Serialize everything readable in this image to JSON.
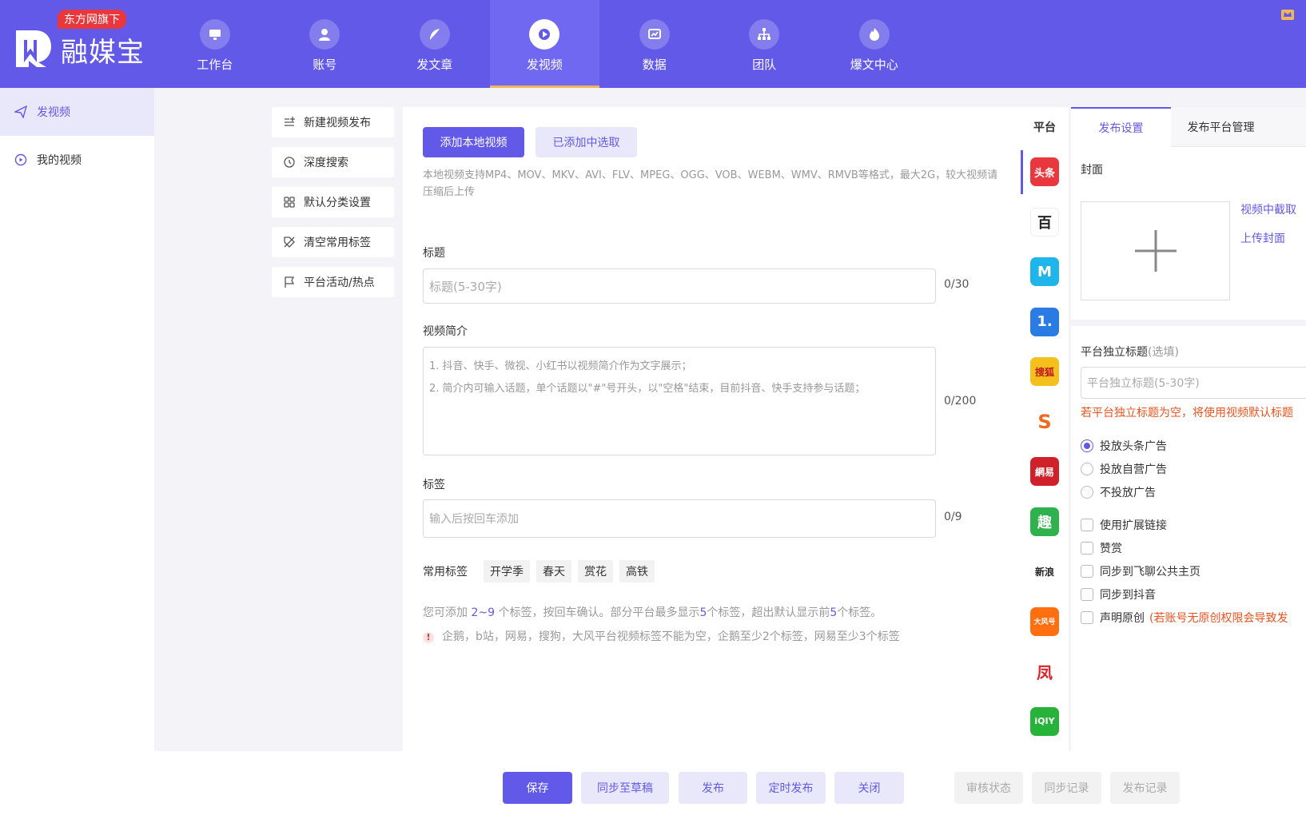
{
  "brand": {
    "name": "融媒宝",
    "badge": "东方网旗下"
  },
  "nav": [
    {
      "label": "工作台",
      "icon": "monitor-icon"
    },
    {
      "label": "账号",
      "icon": "user-icon"
    },
    {
      "label": "发文章",
      "icon": "feather-icon"
    },
    {
      "label": "发视频",
      "icon": "video-play-icon",
      "active": true
    },
    {
      "label": "数据",
      "icon": "chart-icon"
    },
    {
      "label": "团队",
      "icon": "team-icon"
    },
    {
      "label": "爆文中心",
      "icon": "fire-icon"
    }
  ],
  "sidebar": [
    {
      "label": "发视频",
      "active": true
    },
    {
      "label": "我的视频"
    }
  ],
  "tools": [
    "新建视频发布",
    "深度搜索",
    "默认分类设置",
    "清空常用标签",
    "平台活动/热点"
  ],
  "form": {
    "add_local_btn": "添加本地视频",
    "select_added_btn": "已添加中选取",
    "format_hint": "本地视频支持MP4、MOV、MKV、AVI、FLV、MPEG、OGG、VOB、WEBM、WMV、RMVB等格式，最大2G，较大视频请压缩后上传",
    "title_label": "标题",
    "title_placeholder": "标题(5-30字)",
    "title_counter": "0/30",
    "intro_label": "视频简介",
    "intro_placeholder_1": "1. 抖音、快手、微视、小红书以视频简介作为文字展示；",
    "intro_placeholder_2": "2. 简介内可输入话题，单个话题以\"#\"号开头，以\"空格\"结束，目前抖音、快手支持参与话题；",
    "intro_counter": "0/200",
    "tags_label": "标签",
    "tags_placeholder": "输入后按回车添加",
    "tags_counter": "0/9",
    "common_tags_label": "常用标签",
    "common_tags": [
      "开学季",
      "春天",
      "赏花",
      "高铁"
    ],
    "tag_hint_a": "您可添加 ",
    "tag_hint_b": "2~9",
    "tag_hint_c": " 个标签，按回车确认。部分平台最多显示",
    "tag_hint_d": "5",
    "tag_hint_e": "个标签，超出默认显示前",
    "tag_hint_f": "5",
    "tag_hint_g": "个标签。",
    "warning": "企鹅，b站，网易，搜狗，大风平台视频标签不能为空，企鹅至少2个标签，网易至少3个标签"
  },
  "platforms": {
    "header": "平台",
    "items": [
      {
        "name": "toutiao",
        "text": "头条",
        "color": "#e8383d"
      },
      {
        "name": "baijiahao",
        "text": "百",
        "color": "#ffffff"
      },
      {
        "name": "dayu",
        "text": "M",
        "color": "#1fb5ea"
      },
      {
        "name": "yidian",
        "text": "1.",
        "color": "#2a7be4"
      },
      {
        "name": "sohu",
        "text": "搜狐",
        "color": "#f3c01c"
      },
      {
        "name": "qiehao",
        "text": "S",
        "color": "#ffffff"
      },
      {
        "name": "wangyi",
        "text": "網易",
        "color": "#d0202a"
      },
      {
        "name": "qutoutiao",
        "text": "趣",
        "color": "#2fb24d"
      },
      {
        "name": "sina",
        "text": "新浪",
        "color": "#ffffff"
      },
      {
        "name": "dafeng",
        "text": "大风号",
        "color": "#ff6f0f"
      },
      {
        "name": "fenghuang",
        "text": "凤",
        "color": "#ffffff"
      },
      {
        "name": "iqiyi",
        "text": "iQIY",
        "color": "#27b339"
      }
    ]
  },
  "settings": {
    "tab_publish": "发布设置",
    "tab_manage": "发布平台管理",
    "cover_label": "封面",
    "capture_link": "视频中截取",
    "upload_link": "上传封面",
    "indep_title_label": "平台独立标题",
    "indep_title_optional": "(选填)",
    "indep_title_placeholder": "平台独立标题(5-30字)",
    "indep_title_warning": "若平台独立标题为空，将使用视频默认标题",
    "ad_options": [
      "投放头条广告",
      "投放自营广告",
      "不投放广告"
    ],
    "checks": [
      "使用扩展链接",
      "赞赏",
      "同步到飞聊公共主页",
      "同步到抖音",
      "声明原创"
    ],
    "original_note": "(若账号无原创权限会导致发"
  },
  "actions": {
    "save": "保存",
    "sync_draft": "同步至草稿",
    "publish": "发布",
    "schedule": "定时发布",
    "close": "关闭",
    "review_status": "审核状态",
    "sync_log": "同步记录",
    "publish_log": "发布记录"
  },
  "colors": {
    "primary": "#6259e8",
    "soft": "#e9e8fb",
    "accent": "#f0b657",
    "warning": "#e8531f"
  }
}
